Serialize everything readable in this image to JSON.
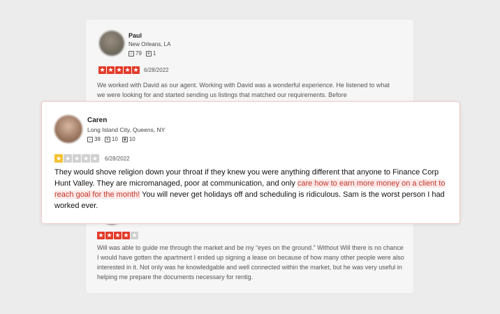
{
  "colors": {
    "star_red": "#e23b2a",
    "star_grey": "#d0d0d0",
    "star_yellow": "#f2c12e",
    "highlight_text": "#c0392b",
    "highlight_bg": "#fde8e8"
  },
  "review1": {
    "name": "Paul",
    "location": "New Orleans, LA",
    "friends": "79",
    "reviews": "1",
    "rating": 5,
    "date": "6/28/2022",
    "text": "We worked with David as our agent. Working with David was a wonderful experience. He listened to what we were looking for and started sending us listings that matched our requirements. Before"
  },
  "review2": {
    "name": "Caren",
    "location": "Long Island City, Queens, NY",
    "friends": "38",
    "reviews": "10",
    "photos": "10",
    "rating": 1,
    "date": "6/28/2022",
    "text_before": "They would shove religion down your throat if they knew you were anything different that anyone to Finance Corp Hunt Valley. They are micromanaged, poor at communication, and only ",
    "text_highlight": "care how to earn more money on a client to reach goal for the month!",
    "text_after": " You will never get holidays off and scheduling is ridiculous. Sam is the worst person I had worked ever."
  },
  "review3": {
    "rating": 4,
    "text": "Will was able to guide me through the market and be my “eyes on the ground.” Without Will there is no chance I would have gotten the apartment I ended up signing a lease on because of how many other people were also interested in it. Not only was he knowledgable and well connected  within the market, but he was very useful in helping me prepare the documents necessary for rentig."
  }
}
